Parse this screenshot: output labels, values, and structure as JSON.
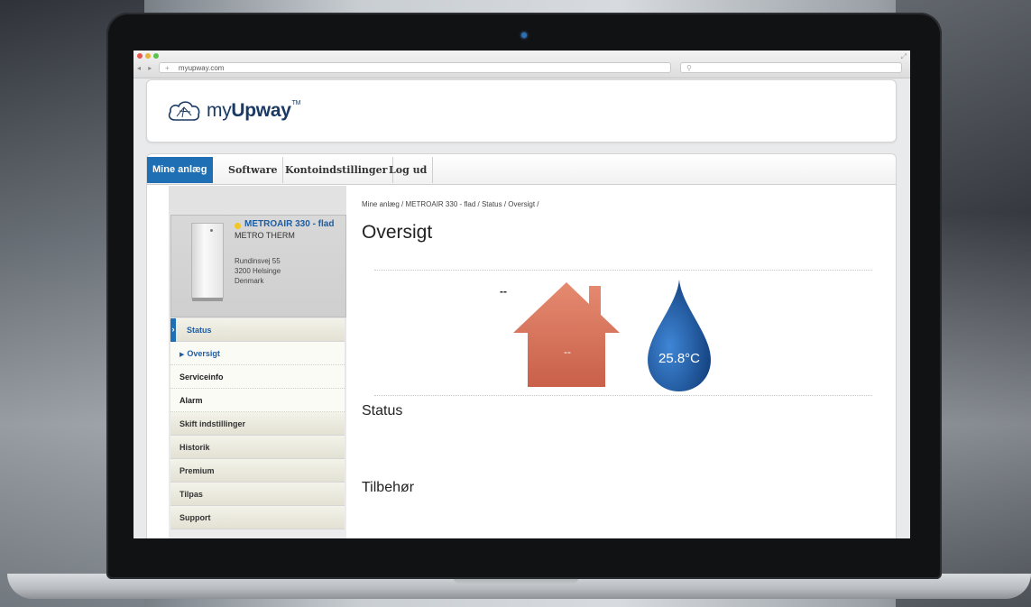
{
  "browser": {
    "url": "myupway.com",
    "nav_glyphs": "◂ ▸",
    "plus": "+",
    "search_icon": "⚲",
    "expand_icon": "⤢"
  },
  "logo": {
    "prefix": "my",
    "bold": "Upway",
    "tm": "TM"
  },
  "tabs": [
    {
      "label": "Mine anlæg",
      "active": true
    },
    {
      "label": "Software"
    },
    {
      "label": "Kontoindstillinger"
    },
    {
      "label": "Log ud"
    }
  ],
  "device": {
    "name": "METROAIR 330 - flad",
    "brand": "METRO THERM",
    "address": [
      "Rundinsvej 55",
      "3200 Helsinge",
      "Denmark"
    ],
    "status_color": "#f3c623"
  },
  "menu": [
    {
      "label": "Status",
      "kind": "status"
    },
    {
      "label": "Oversigt",
      "kind": "current"
    },
    {
      "label": "Serviceinfo",
      "kind": "sub"
    },
    {
      "label": "Alarm",
      "kind": "sub"
    },
    {
      "label": "Skift indstillinger",
      "kind": "main"
    },
    {
      "label": "Historik",
      "kind": "main"
    },
    {
      "label": "Premium",
      "kind": "main"
    },
    {
      "label": "Tilpas",
      "kind": "main"
    },
    {
      "label": "Support",
      "kind": "main"
    }
  ],
  "content": {
    "breadcrumb": "Mine anlæg / METROAIR 330 - flad / Status / Oversigt /",
    "title": "Oversigt",
    "outdoor_temp": "--",
    "house_temp": "--",
    "water_temp": "25.8°C",
    "section_status": "Status",
    "section_accessories": "Tilbehør"
  },
  "colors": {
    "accent": "#1e6fb3",
    "house": "#d9715a",
    "drop": "#1d5aa4"
  }
}
